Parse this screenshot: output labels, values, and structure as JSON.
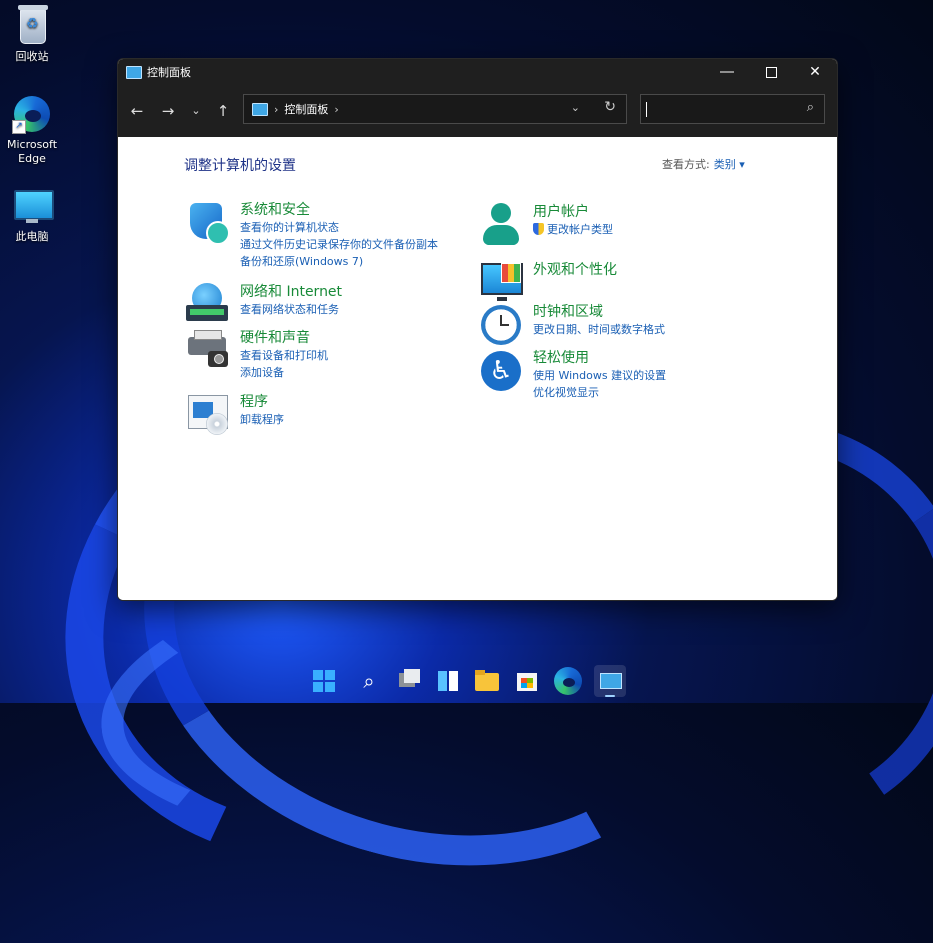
{
  "desktop": {
    "icons": [
      {
        "label": "回收站"
      },
      {
        "label": "Microsoft\nEdge"
      },
      {
        "label": "此电脑"
      }
    ]
  },
  "window": {
    "title": "控制面板",
    "address": {
      "segment": "控制面板",
      "chevron": "›"
    },
    "search": {
      "placeholder": ""
    },
    "heading": "调整计算机的设置",
    "view_by": {
      "label": "查看方式:",
      "value": "类别 ▾"
    },
    "categories_left": [
      {
        "title": "系统和安全",
        "links": [
          "查看你的计算机状态",
          "通过文件历史记录保存你的文件备份副本",
          "备份和还原(Windows 7)"
        ],
        "icon": "shield-icon"
      },
      {
        "title": "网络和 Internet",
        "links": [
          "查看网络状态和任务"
        ],
        "icon": "network-icon"
      },
      {
        "title": "硬件和声音",
        "links": [
          "查看设备和打印机",
          "添加设备"
        ],
        "icon": "printer-icon"
      },
      {
        "title": "程序",
        "links": [
          "卸载程序"
        ],
        "icon": "programs-icon"
      }
    ],
    "categories_right": [
      {
        "title": "用户帐户",
        "links": [
          "更改帐户类型"
        ],
        "icon": "user-icon"
      },
      {
        "title": "外观和个性化",
        "links": [],
        "icon": "appearance-icon"
      },
      {
        "title": "时钟和区域",
        "links": [
          "更改日期、时间或数字格式"
        ],
        "icon": "clock-icon"
      },
      {
        "title": "轻松使用",
        "links": [
          "使用 Windows 建议的设置",
          "优化视觉显示"
        ],
        "icon": "accessibility-icon"
      }
    ]
  },
  "taskbar": {
    "items": [
      "start-icon",
      "search-icon",
      "task-view-icon",
      "widgets-icon",
      "file-explorer-icon",
      "store-icon",
      "edge-icon",
      "control-panel-icon"
    ]
  },
  "colors": {
    "link": "#1a5fb4",
    "category_title": "#188a38",
    "heading": "#1e3287",
    "titlebar": "#1f1f1f"
  }
}
